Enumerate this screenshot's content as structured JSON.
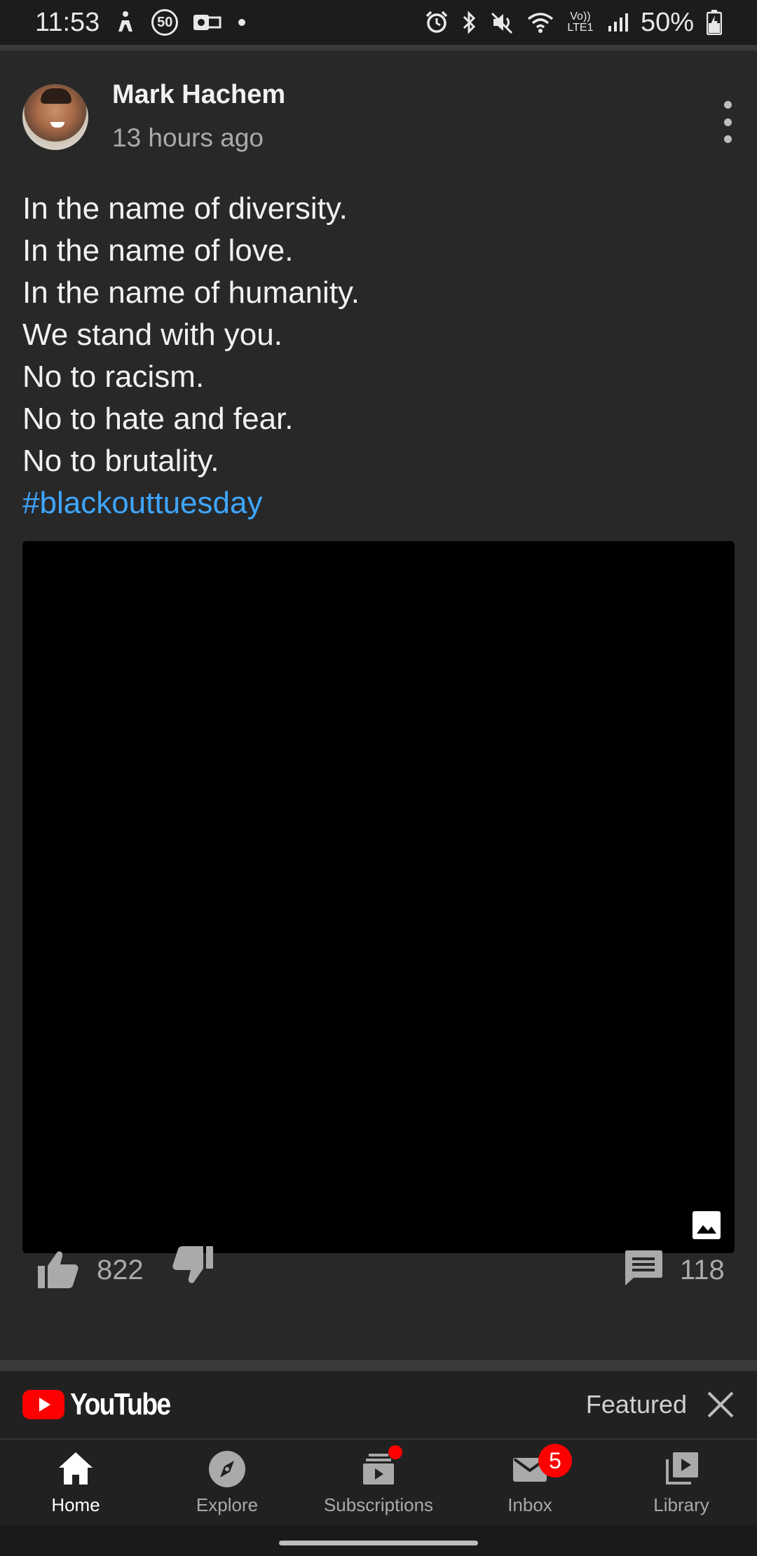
{
  "status_bar": {
    "time": "11:53",
    "speed_badge": "50",
    "lte_label": "Vo)) LTE1",
    "battery": "50%"
  },
  "post": {
    "author": "Mark Hachem",
    "time": "13 hours ago",
    "lines": [
      "In the name of diversity.",
      "In the name of love.",
      "In the name of humanity.",
      "We stand with you.",
      "No to racism.",
      "No to hate and fear.",
      "No to brutality."
    ],
    "hashtag": "#blackouttuesday",
    "likes": "822",
    "comments": "118"
  },
  "yt_bar": {
    "logo_text": "YouTube",
    "featured_label": "Featured"
  },
  "nav": {
    "home": "Home",
    "explore": "Explore",
    "subscriptions": "Subscriptions",
    "inbox": "Inbox",
    "inbox_badge": "5",
    "library": "Library"
  },
  "colors": {
    "background": "#282828",
    "hashtag": "#3ea6ff",
    "youtube_red": "#ff0000"
  }
}
